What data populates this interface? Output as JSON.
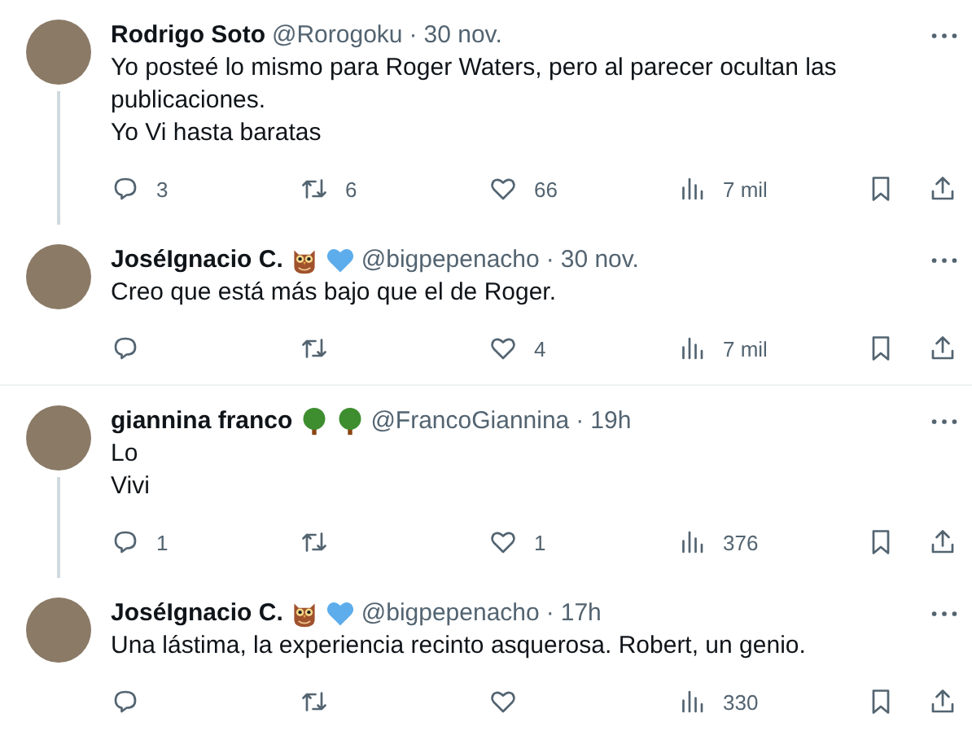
{
  "threads": [
    [
      {
        "name": "Rodrigo Soto",
        "handle": "@Rorogoku",
        "separator": "·",
        "time": "30 nov.",
        "lines": [
          "Yo posteé lo mismo para Roger Waters, pero al parecer ocultan las publicaciones.",
          "Yo Vi hasta baratas"
        ],
        "replies": "3",
        "retweets": "6",
        "likes": "66",
        "views": "7 mil"
      },
      {
        "name": "JoséIgnacio C.",
        "badges": [
          {
            "kind": "owl"
          },
          {
            "kind": "heart"
          }
        ],
        "handle": "@bigpepenacho",
        "separator": "·",
        "time": "30 nov.",
        "lines": [
          "Creo que está más bajo que el de Roger."
        ],
        "likes": "4",
        "views": "7 mil"
      }
    ],
    [
      {
        "name": "giannina franco",
        "badges": [
          {
            "kind": "tree"
          },
          {
            "kind": "tree"
          }
        ],
        "handle": "@FrancoGiannina",
        "separator": "·",
        "time": "19h",
        "lines": [
          "Lo",
          "Vivi"
        ],
        "replies": "1",
        "likes": "1",
        "views": "376"
      },
      {
        "name": "JoséIgnacio C.",
        "badges": [
          {
            "kind": "owl"
          },
          {
            "kind": "heart"
          }
        ],
        "handle": "@bigpepenacho",
        "separator": "·",
        "time": "17h",
        "lines": [
          "Una lástima, la experiencia recinto asquerosa. Robert, un genio."
        ],
        "views": "330"
      }
    ]
  ]
}
